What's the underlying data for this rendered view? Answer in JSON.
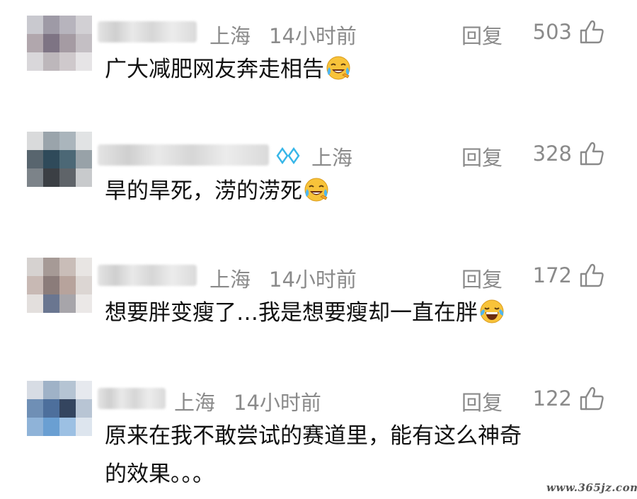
{
  "comments": [
    {
      "location": "上海",
      "time": "14小时前",
      "reply_label": "回复",
      "likes": "503",
      "text": "广大减肥网友奔走相告",
      "emoji": "crying-laughing-face"
    },
    {
      "location": "上海",
      "time": "",
      "reply_label": "回复",
      "likes": "328",
      "text": "旱的旱死，涝的涝死",
      "emoji": "crying-laughing-face",
      "badge": "vip-diamond-icon"
    },
    {
      "location": "上海",
      "time": "14小时前",
      "reply_label": "回复",
      "likes": "172",
      "text": "想要胖变瘦了…我是想要瘦却一直在胖",
      "emoji": "tears-of-joy-face"
    },
    {
      "location": "上海",
      "time": "14小时前",
      "reply_label": "回复",
      "likes": "122",
      "text_line1": "原来在我不敢尝试的赛道里，能有这么神奇",
      "text_line2": "的效果。。。"
    }
  ],
  "watermark": "www.365jz.com",
  "colors": {
    "meta_text": "#8a8a8a",
    "content_text": "#111111",
    "vip_badge": "#37b6e8",
    "emoji_yellow": "#f8c33a"
  }
}
